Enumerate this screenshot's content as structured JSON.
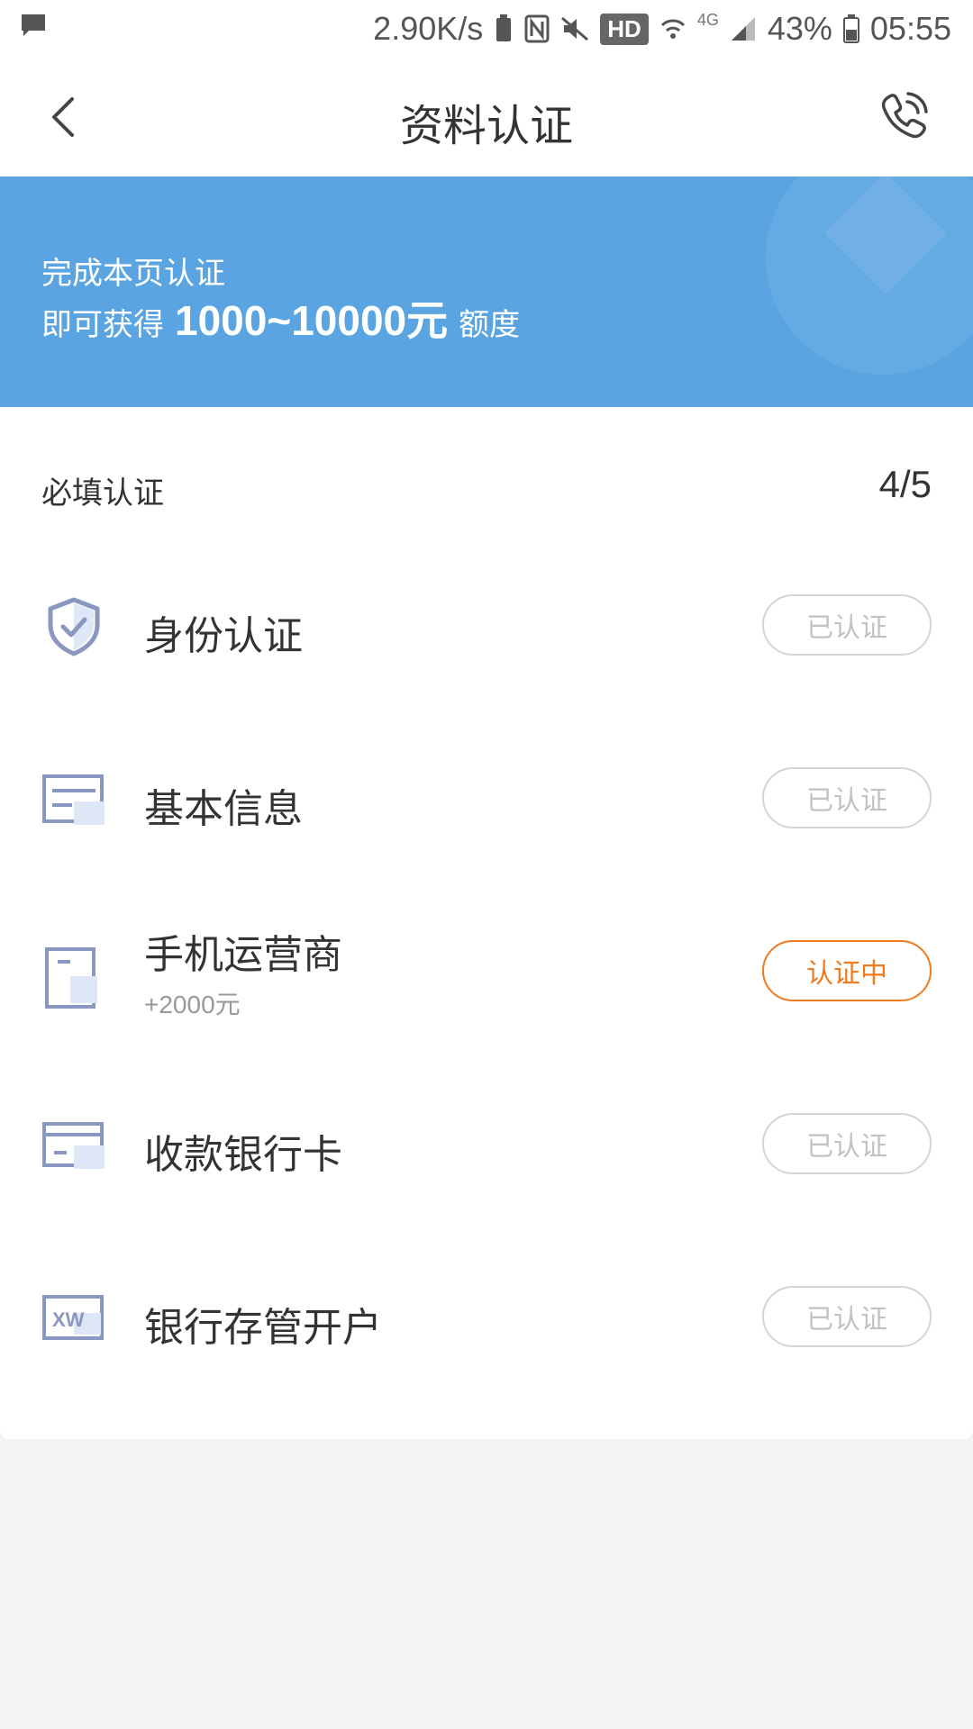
{
  "status_bar": {
    "speed": "2.90K/s",
    "hd": "HD",
    "network": "4G",
    "battery": "43%",
    "time": "05:55"
  },
  "header": {
    "title": "资料认证"
  },
  "banner": {
    "line1": "完成本页认证",
    "line2_prefix": "即可获得",
    "amount": "1000~10000元",
    "line2_suffix": "额度"
  },
  "section": {
    "label": "必填认证",
    "count": "4/5"
  },
  "items": [
    {
      "title": "身份认证",
      "subtitle": "",
      "status": "已认证",
      "icon": "shield-check-icon"
    },
    {
      "title": "基本信息",
      "subtitle": "",
      "status": "已认证",
      "icon": "info-card-icon"
    },
    {
      "title": "手机运营商",
      "subtitle": "+2000元",
      "status": "认证中",
      "icon": "phone-operator-icon"
    },
    {
      "title": "收款银行卡",
      "subtitle": "",
      "status": "已认证",
      "icon": "bank-card-icon"
    },
    {
      "title": "银行存管开户",
      "subtitle": "",
      "status": "已认证",
      "icon": "xw-bank-icon"
    }
  ],
  "colors": {
    "banner": "#5aa5e1",
    "active_status": "#f07a1e",
    "icon_stroke": "#8a97c0"
  }
}
